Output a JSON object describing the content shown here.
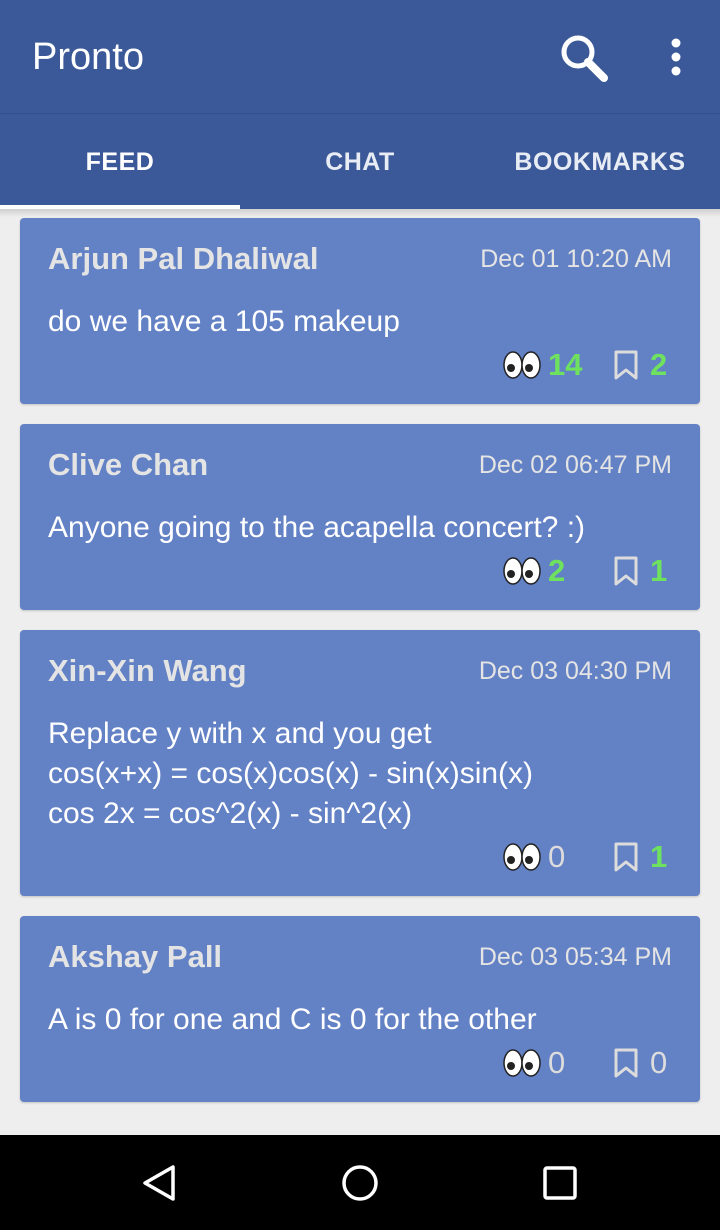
{
  "app": {
    "title": "Pronto"
  },
  "tabs": [
    {
      "label": "FEED",
      "active": true
    },
    {
      "label": "CHAT",
      "active": false
    },
    {
      "label": "BOOKMARKS",
      "active": false
    }
  ],
  "posts": [
    {
      "author": "Arjun Pal Dhaliwal",
      "time": "Dec 01 10:20 AM",
      "message": "do we have a 105 makeup",
      "views": "14",
      "bookmarks": "2"
    },
    {
      "author": "Clive Chan",
      "time": "Dec 02 06:47 PM",
      "message": "Anyone going to the acapella concert? :)",
      "views": "2",
      "bookmarks": "1"
    },
    {
      "author": "Xin-Xin Wang",
      "time": "Dec 03 04:30 PM",
      "message": "Replace y with x and you get\ncos(x+x) = cos(x)cos(x) - sin(x)sin(x)\ncos 2x = cos^2(x) - sin^2(x)",
      "views": "0",
      "bookmarks": "1"
    },
    {
      "author": "Akshay Pall",
      "time": "Dec 03 05:34 PM",
      "message": "A is 0 for one and C is 0 for the other",
      "views": "0",
      "bookmarks": "0"
    }
  ],
  "colors": {
    "primary": "#3b5998",
    "card": "#6381c5",
    "highlight_count": "#6ee25f",
    "zero_count": "#dcdcdc"
  },
  "icons": {
    "search": "search-icon",
    "overflow": "more-vert-icon",
    "views": "eyes-icon",
    "bookmark": "bookmark-icon",
    "nav_back": "back-triangle-icon",
    "nav_home": "home-circle-icon",
    "nav_recents": "recents-square-icon"
  }
}
